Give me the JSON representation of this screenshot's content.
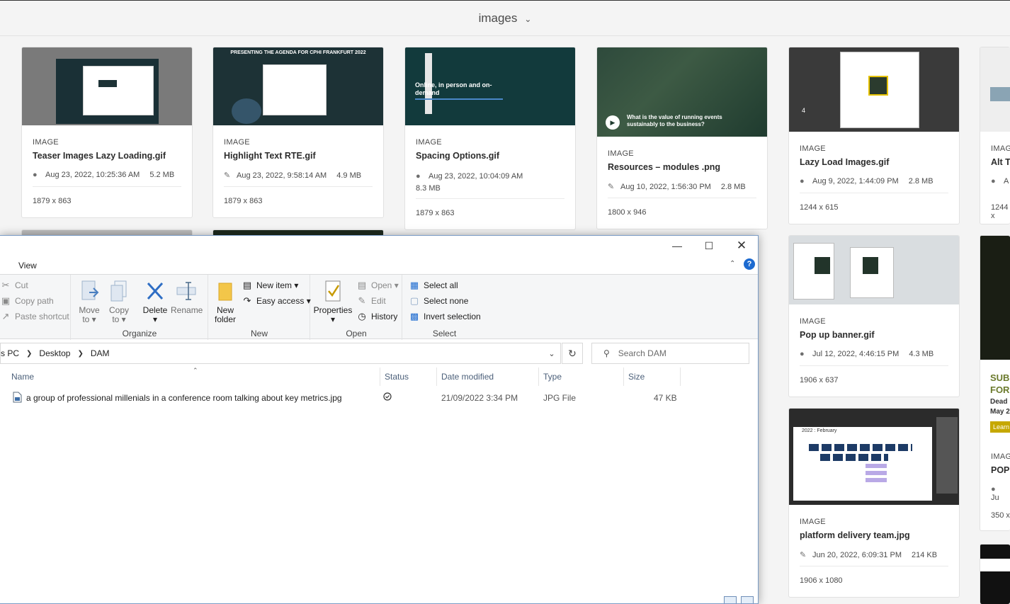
{
  "dam": {
    "folder_title": "images",
    "cards": [
      {
        "type": "IMAGE",
        "name": "Teaser Images Lazy Loading.gif",
        "date": "Aug 23, 2022, 10:25:36 AM",
        "size": "5.2 MB",
        "dims": "1879 x 863",
        "status_icon": "globe-icon"
      },
      {
        "type": "IMAGE",
        "name": "Highlight Text RTE.gif",
        "date": "Aug 23, 2022, 9:58:14 AM",
        "size": "4.9 MB",
        "dims": "1879 x 863",
        "status_icon": "pencil-icon",
        "thumb_text": "PRESENTING THE AGENDA FOR CPHI FRANKFURT 2022"
      },
      {
        "type": "IMAGE",
        "name": "Spacing Options.gif",
        "date": "Aug 23, 2022, 10:04:09 AM",
        "size": "8.3 MB",
        "dims": "1879 x 863",
        "status_icon": "globe-icon",
        "thumb_text": "Online, in person and on-demand"
      },
      {
        "type": "IMAGE",
        "name": "Resources – modules .png",
        "date": "Aug 10, 2022, 1:56:30 PM",
        "size": "2.8 MB",
        "dims": "1800 x 946",
        "status_icon": "pencil-icon",
        "thumb_text": "What is the value of running events sustainably to the business?"
      },
      {
        "type": "IMAGE",
        "name": "Lazy Load Images.gif",
        "date": "Aug 9, 2022, 1:44:09 PM",
        "size": "2.8 MB",
        "dims": "1244 x 615",
        "status_icon": "globe-icon"
      },
      {
        "type": "IMAGE",
        "name": "Pop up banner.gif",
        "date": "Jul 12, 2022, 4:46:15 PM",
        "size": "4.3 MB",
        "dims": "1906 x 637",
        "status_icon": "globe-icon"
      },
      {
        "type": "IMAGE",
        "name": "platform delivery team.jpg",
        "date": "Jun 20, 2022, 6:09:31 PM",
        "size": "214 KB",
        "dims": "1906 x 1080",
        "status_icon": "pencil-icon",
        "thumb_text": "2022 : February"
      },
      {
        "type": "IMAG",
        "name": "Alt Te",
        "date": "A",
        "dims": "1244 x"
      },
      {
        "type": "IMAG",
        "name": "POP",
        "date": "Ju",
        "dims": "350 x",
        "thumb_text": [
          "SUB",
          "FOR",
          "Dead",
          "May 2",
          "Learn"
        ]
      }
    ]
  },
  "explorer": {
    "tab": "View",
    "ribbon": {
      "clipboard": {
        "cut": "Cut",
        "copy_path": "Copy path",
        "paste_shortcut": "Paste shortcut"
      },
      "organize": {
        "label": "Organize",
        "move_to": [
          "Move",
          "to"
        ],
        "copy_to": [
          "Copy",
          "to"
        ],
        "delete": "Delete",
        "rename": "Rename"
      },
      "new": {
        "label": "New",
        "new_folder": [
          "New",
          "folder"
        ],
        "new_item": "New item",
        "easy_access": "Easy access"
      },
      "open": {
        "label": "Open",
        "properties": "Properties",
        "open": "Open",
        "edit": "Edit",
        "history": "History"
      },
      "select": {
        "label": "Select",
        "select_all": "Select all",
        "select_none": "Select none",
        "invert_selection": "Invert selection"
      }
    },
    "address": {
      "crumbs": [
        "s PC",
        "Desktop",
        "DAM"
      ]
    },
    "search_placeholder": "Search DAM",
    "columns": [
      "Name",
      "Status",
      "Date modified",
      "Type",
      "Size"
    ],
    "files": [
      {
        "name": "a group of professional millenials in a conference room talking about key metrics.jpg",
        "status": "synced",
        "date_modified": "21/09/2022 3:34 PM",
        "type": "JPG File",
        "size": "47 KB"
      }
    ]
  }
}
